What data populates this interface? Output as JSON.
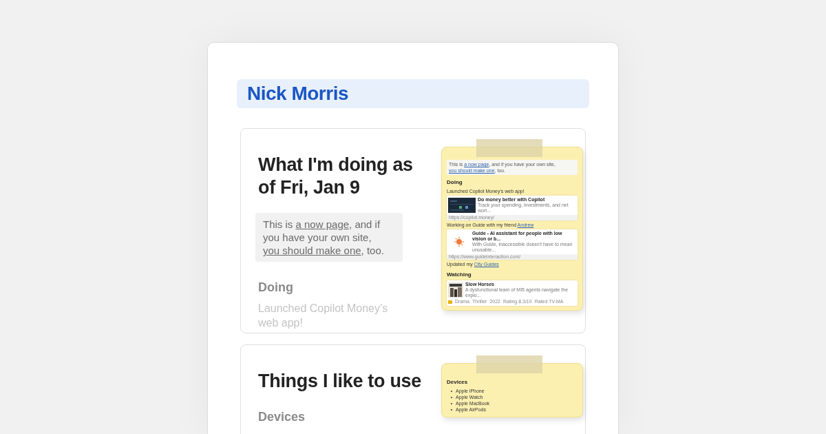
{
  "header": {
    "name": "Nick Morris"
  },
  "sections": [
    {
      "title": "What I'm doing as of Fri, Jan 9",
      "intro": [
        {
          "text": "This is ",
          "link": false
        },
        {
          "text": "a now page",
          "link": true
        },
        {
          "text": ", and if you have your own site, ",
          "link": false
        },
        {
          "text": "you should make one",
          "link": true
        },
        {
          "text": ", too.",
          "link": false
        }
      ],
      "heading": "Doing",
      "faded_text": "Launched Copilot Money’s web app!",
      "note": [
        {
          "kind": "intro",
          "parts": [
            {
              "text": "This is ",
              "link": false
            },
            {
              "text": "a now page",
              "link": true
            },
            {
              "text": ", and if you have your own site, ",
              "link": false
            },
            {
              "text": "you should make one",
              "link": true
            },
            {
              "text": ", too.",
              "link": false
            }
          ]
        },
        {
          "kind": "heading",
          "text": "Doing"
        },
        {
          "kind": "text",
          "parts": [
            {
              "text": "Launched Copilot Money's web app!",
              "link": false
            }
          ]
        },
        {
          "kind": "preview_card",
          "title": "Do money better with Copilot",
          "description": "Track your spending, investments, and net wort...",
          "url": "https://copilot.money/"
        },
        {
          "kind": "text",
          "parts": [
            {
              "text": "Working on Guide with my friend ",
              "link": false
            },
            {
              "text": "Andrew",
              "link": true
            }
          ]
        },
        {
          "kind": "app_card",
          "title": "Guide - AI assistant for people with low vision or b...",
          "description": "With Guide, inaccessible doesn't have to mean unusable...",
          "url": "https://www.guideinteraction.com/"
        },
        {
          "kind": "text",
          "parts": [
            {
              "text": "Updated my ",
              "link": false
            },
            {
              "text": "City Guides",
              "link": true
            }
          ]
        },
        {
          "kind": "heading",
          "text": "Watching"
        },
        {
          "kind": "media_card",
          "title": "Slow Horses",
          "description": "A dysfunctional team of MI5 agents navigate the explo...",
          "meta": [
            "Drama",
            "Thriller",
            "2022",
            "Rating 8.3/10",
            "Rated TV-MA"
          ]
        }
      ]
    },
    {
      "title": "Things I like to use",
      "heading": "Devices",
      "note": [
        {
          "kind": "heading",
          "text": "Devices"
        },
        {
          "kind": "list",
          "items": [
            "Apple iPhone",
            "Apple Watch",
            "Apple MacBook",
            "Apple AirPods"
          ]
        }
      ]
    }
  ]
}
